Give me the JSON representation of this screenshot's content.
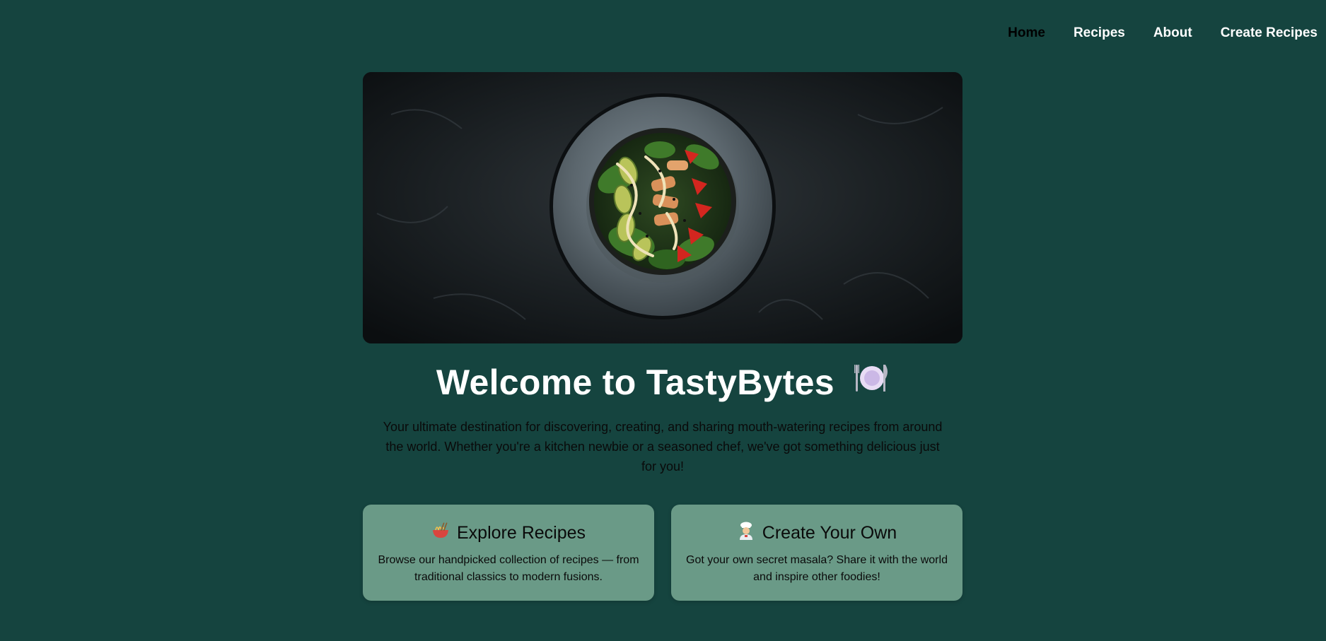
{
  "nav": {
    "items": [
      {
        "label": "Home",
        "active": true
      },
      {
        "label": "Recipes",
        "active": false
      },
      {
        "label": "About",
        "active": false
      },
      {
        "label": "Create Recipes",
        "active": false
      }
    ]
  },
  "hero": {
    "image_icon": "salad-bowl-photo"
  },
  "main": {
    "title": "Welcome to TastyBytes",
    "title_icon": "fork-knife-plate-icon",
    "subtitle": "Your ultimate destination for discovering, creating, and sharing mouth-watering recipes from around the world. Whether you're a kitchen newbie or a seasoned chef, we've got something delicious just for you!"
  },
  "cards": [
    {
      "icon": "noodle-bowl-icon",
      "title": "Explore Recipes",
      "description": "Browse our handpicked collection of recipes — from traditional classics to modern fusions."
    },
    {
      "icon": "chef-icon",
      "title": "Create Your Own",
      "description": "Got your own secret masala? Share it with the world and inspire other foodies!"
    }
  ],
  "colors": {
    "background": "#15443f",
    "card": "#6a9a87",
    "nav_text": "#ffffff",
    "nav_active": "#000000"
  }
}
